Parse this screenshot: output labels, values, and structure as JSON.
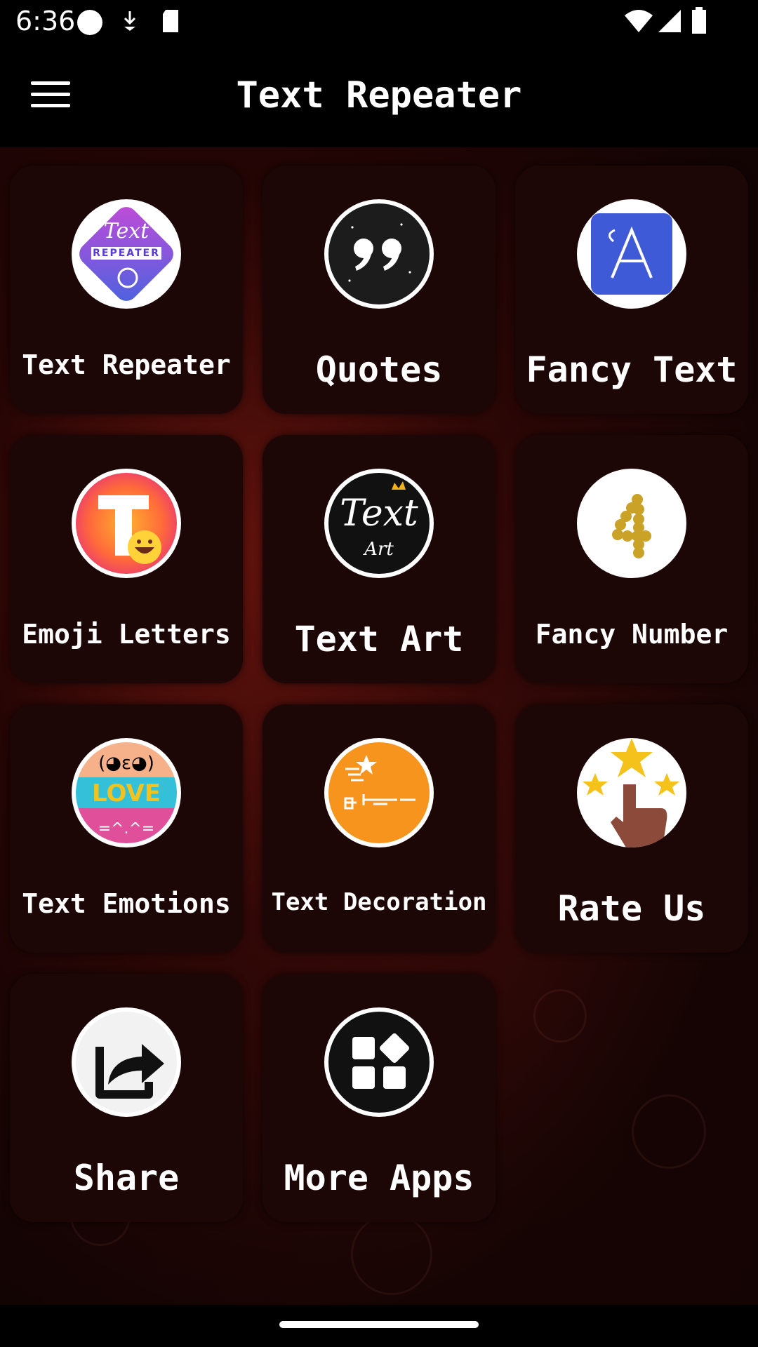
{
  "status_bar": {
    "time": "6:36"
  },
  "app_bar": {
    "title": "Text Repeater"
  },
  "tiles": [
    {
      "label": "Text Repeater",
      "icon": "text-repeater-logo-icon"
    },
    {
      "label": "Quotes",
      "icon": "quote-marks-icon"
    },
    {
      "label": "Fancy Text",
      "icon": "fancy-letter-a-icon"
    },
    {
      "label": "Emoji Letters",
      "icon": "emoji-letter-t-icon"
    },
    {
      "label": "Text Art",
      "icon": "text-art-crown-icon"
    },
    {
      "label": "Fancy Number",
      "icon": "gold-number-4-icon"
    },
    {
      "label": "Text Emotions",
      "icon": "love-emoticon-icon"
    },
    {
      "label": "Text Decoration",
      "icon": "decoration-star-icon"
    },
    {
      "label": "Rate Us",
      "icon": "hand-stars-icon"
    },
    {
      "label": "Share",
      "icon": "share-arrow-icon"
    },
    {
      "label": "More Apps",
      "icon": "apps-grid-icon"
    }
  ],
  "icon_text": {
    "repeater_top": "Text",
    "repeater_banner": "REPEATER",
    "text_art_main": "Text",
    "text_art_sub": "Art"
  },
  "colors": {
    "tile_background": "#1d0606",
    "background_accent": "#8a1c12"
  }
}
